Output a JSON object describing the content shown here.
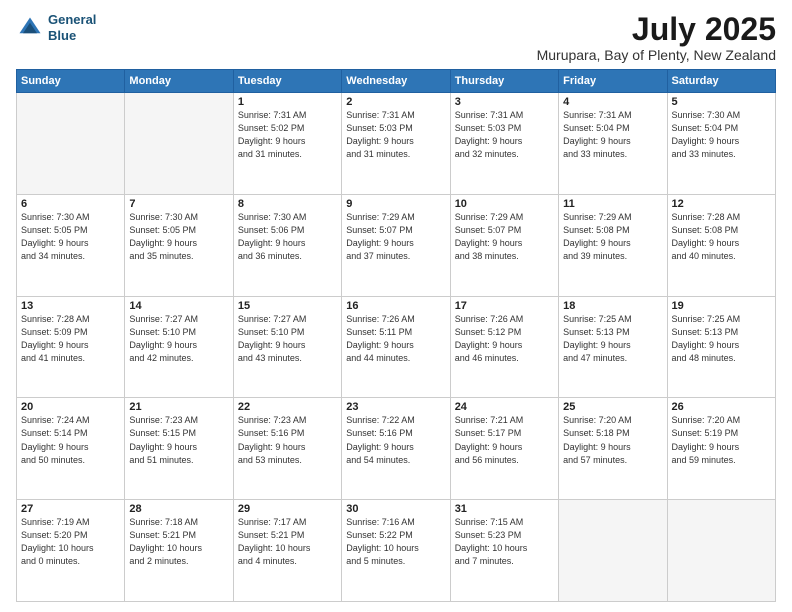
{
  "logo": {
    "line1": "General",
    "line2": "Blue"
  },
  "title": "July 2025",
  "subtitle": "Murupara, Bay of Plenty, New Zealand",
  "days_header": [
    "Sunday",
    "Monday",
    "Tuesday",
    "Wednesday",
    "Thursday",
    "Friday",
    "Saturday"
  ],
  "weeks": [
    [
      {
        "day": "",
        "info": ""
      },
      {
        "day": "",
        "info": ""
      },
      {
        "day": "1",
        "info": "Sunrise: 7:31 AM\nSunset: 5:02 PM\nDaylight: 9 hours\nand 31 minutes."
      },
      {
        "day": "2",
        "info": "Sunrise: 7:31 AM\nSunset: 5:03 PM\nDaylight: 9 hours\nand 31 minutes."
      },
      {
        "day": "3",
        "info": "Sunrise: 7:31 AM\nSunset: 5:03 PM\nDaylight: 9 hours\nand 32 minutes."
      },
      {
        "day": "4",
        "info": "Sunrise: 7:31 AM\nSunset: 5:04 PM\nDaylight: 9 hours\nand 33 minutes."
      },
      {
        "day": "5",
        "info": "Sunrise: 7:30 AM\nSunset: 5:04 PM\nDaylight: 9 hours\nand 33 minutes."
      }
    ],
    [
      {
        "day": "6",
        "info": "Sunrise: 7:30 AM\nSunset: 5:05 PM\nDaylight: 9 hours\nand 34 minutes."
      },
      {
        "day": "7",
        "info": "Sunrise: 7:30 AM\nSunset: 5:05 PM\nDaylight: 9 hours\nand 35 minutes."
      },
      {
        "day": "8",
        "info": "Sunrise: 7:30 AM\nSunset: 5:06 PM\nDaylight: 9 hours\nand 36 minutes."
      },
      {
        "day": "9",
        "info": "Sunrise: 7:29 AM\nSunset: 5:07 PM\nDaylight: 9 hours\nand 37 minutes."
      },
      {
        "day": "10",
        "info": "Sunrise: 7:29 AM\nSunset: 5:07 PM\nDaylight: 9 hours\nand 38 minutes."
      },
      {
        "day": "11",
        "info": "Sunrise: 7:29 AM\nSunset: 5:08 PM\nDaylight: 9 hours\nand 39 minutes."
      },
      {
        "day": "12",
        "info": "Sunrise: 7:28 AM\nSunset: 5:08 PM\nDaylight: 9 hours\nand 40 minutes."
      }
    ],
    [
      {
        "day": "13",
        "info": "Sunrise: 7:28 AM\nSunset: 5:09 PM\nDaylight: 9 hours\nand 41 minutes."
      },
      {
        "day": "14",
        "info": "Sunrise: 7:27 AM\nSunset: 5:10 PM\nDaylight: 9 hours\nand 42 minutes."
      },
      {
        "day": "15",
        "info": "Sunrise: 7:27 AM\nSunset: 5:10 PM\nDaylight: 9 hours\nand 43 minutes."
      },
      {
        "day": "16",
        "info": "Sunrise: 7:26 AM\nSunset: 5:11 PM\nDaylight: 9 hours\nand 44 minutes."
      },
      {
        "day": "17",
        "info": "Sunrise: 7:26 AM\nSunset: 5:12 PM\nDaylight: 9 hours\nand 46 minutes."
      },
      {
        "day": "18",
        "info": "Sunrise: 7:25 AM\nSunset: 5:13 PM\nDaylight: 9 hours\nand 47 minutes."
      },
      {
        "day": "19",
        "info": "Sunrise: 7:25 AM\nSunset: 5:13 PM\nDaylight: 9 hours\nand 48 minutes."
      }
    ],
    [
      {
        "day": "20",
        "info": "Sunrise: 7:24 AM\nSunset: 5:14 PM\nDaylight: 9 hours\nand 50 minutes."
      },
      {
        "day": "21",
        "info": "Sunrise: 7:23 AM\nSunset: 5:15 PM\nDaylight: 9 hours\nand 51 minutes."
      },
      {
        "day": "22",
        "info": "Sunrise: 7:23 AM\nSunset: 5:16 PM\nDaylight: 9 hours\nand 53 minutes."
      },
      {
        "day": "23",
        "info": "Sunrise: 7:22 AM\nSunset: 5:16 PM\nDaylight: 9 hours\nand 54 minutes."
      },
      {
        "day": "24",
        "info": "Sunrise: 7:21 AM\nSunset: 5:17 PM\nDaylight: 9 hours\nand 56 minutes."
      },
      {
        "day": "25",
        "info": "Sunrise: 7:20 AM\nSunset: 5:18 PM\nDaylight: 9 hours\nand 57 minutes."
      },
      {
        "day": "26",
        "info": "Sunrise: 7:20 AM\nSunset: 5:19 PM\nDaylight: 9 hours\nand 59 minutes."
      }
    ],
    [
      {
        "day": "27",
        "info": "Sunrise: 7:19 AM\nSunset: 5:20 PM\nDaylight: 10 hours\nand 0 minutes."
      },
      {
        "day": "28",
        "info": "Sunrise: 7:18 AM\nSunset: 5:21 PM\nDaylight: 10 hours\nand 2 minutes."
      },
      {
        "day": "29",
        "info": "Sunrise: 7:17 AM\nSunset: 5:21 PM\nDaylight: 10 hours\nand 4 minutes."
      },
      {
        "day": "30",
        "info": "Sunrise: 7:16 AM\nSunset: 5:22 PM\nDaylight: 10 hours\nand 5 minutes."
      },
      {
        "day": "31",
        "info": "Sunrise: 7:15 AM\nSunset: 5:23 PM\nDaylight: 10 hours\nand 7 minutes."
      },
      {
        "day": "",
        "info": ""
      },
      {
        "day": "",
        "info": ""
      }
    ]
  ]
}
